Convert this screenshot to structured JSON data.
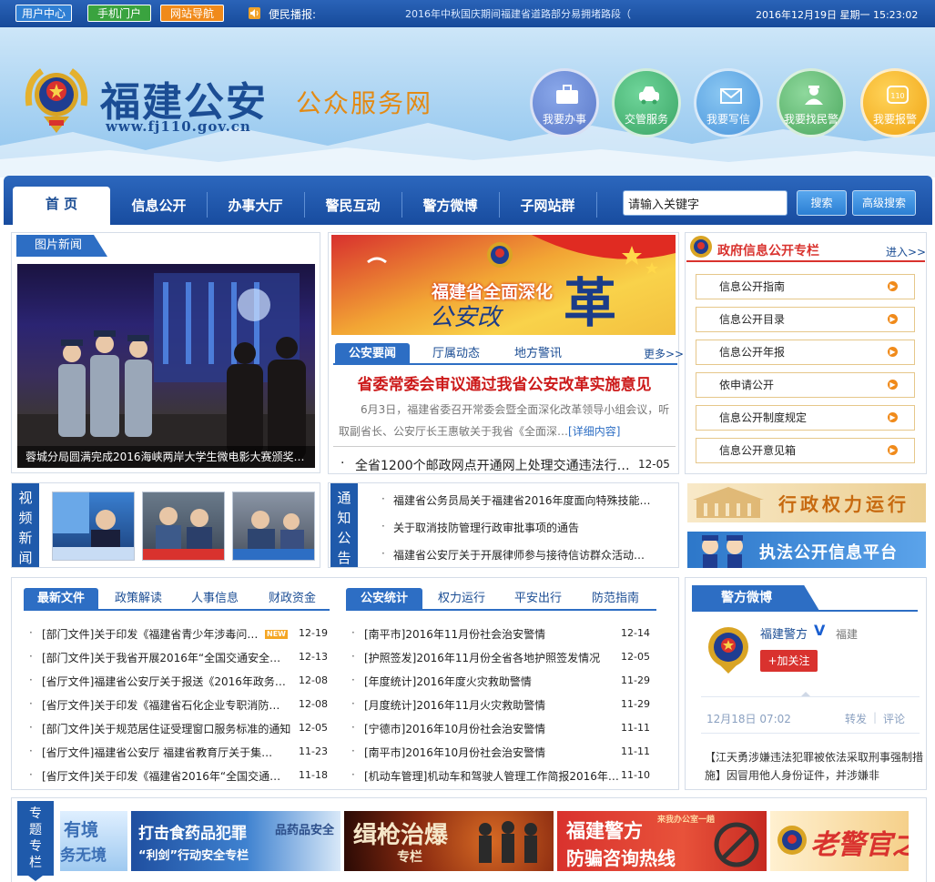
{
  "topbar": {
    "user_center": "用户中心",
    "mobile_portal": "手机门户",
    "site_nav": "网站导航",
    "notice_label": "便民播报:",
    "notice_text": "2016年中秋国庆期间福建省道路部分易拥堵路段（",
    "datetime": "2016年12月19日  星期一  15:23:02"
  },
  "header": {
    "logo_cn": "福建公安",
    "logo_sub": "公众服务网",
    "logo_url": "www.fj110.gov.cn",
    "services": [
      "我要办事",
      "交管服务",
      "我要写信",
      "我要找民警",
      "我要报警"
    ],
    "service_colors": [
      "#6f8fd8",
      "#4cba7a",
      "#5aa7e6",
      "#67c07a",
      "#f2b318"
    ]
  },
  "nav": {
    "items": [
      "首 页",
      "信息公开",
      "办事大厅",
      "警民互动",
      "警方微博",
      "子网站群"
    ],
    "search_placeholder": "请输入关键字",
    "search_btn": "搜索",
    "adv_search_btn": "高级搜索"
  },
  "picture_news": {
    "tab": "图片新闻",
    "caption": "蓉城分局圆满完成2016海峡两岸大学生微电影大赛颁奖…"
  },
  "reform": {
    "line1": "福建省全面深化",
    "line2": "公安改",
    "big": "革"
  },
  "news": {
    "tabs": [
      "公安要闻",
      "厅属动态",
      "地方警讯"
    ],
    "more": "更多>>",
    "headline": "省委常委会审议通过我省公安改革实施意见",
    "desc": "6月3日，福建省委召开常委会暨全面深化改革领导小组会议，听取副省长、公安厅长王惠敏关于我省《全面深…",
    "detail": "[详细内容]",
    "item_text": "全省1200个邮政网点开通网上处理交通违法行…",
    "item_date": "12-05"
  },
  "gov_info": {
    "title": "政府信息公开专栏",
    "more": "进入>>",
    "items": [
      "信息公开指南",
      "信息公开目录",
      "信息公开年报",
      "依申请公开",
      "信息公开制度规定",
      "信息公开意见箱"
    ]
  },
  "video": {
    "label": [
      "视",
      "频",
      "新",
      "闻"
    ]
  },
  "notice": {
    "label": [
      "通",
      "知",
      "公",
      "告"
    ],
    "items": [
      "福建省公务员局关于福建省2016年度面向特殊技能…",
      "关于取消技防管理行政审批事项的通告",
      "福建省公安厅关于开展律师参与接待信访群众活动…"
    ]
  },
  "banners": {
    "power": "行政权力运行",
    "law": "执法公开信息平台"
  },
  "docs": {
    "tabs": [
      "最新文件",
      "政策解读",
      "人事信息",
      "财政资金"
    ],
    "new_badge": "NEW",
    "items": [
      {
        "text": "[部门文件]关于印发《福建省青少年涉毒问…",
        "date": "12-19"
      },
      {
        "text": "[部门文件]关于我省开展2016年“全国交通安全…",
        "date": "12-13"
      },
      {
        "text": "[省厅文件]福建省公安厅关于报送《2016年政务…",
        "date": "12-08"
      },
      {
        "text": "[省厅文件]关于印发《福建省石化企业专职消防…",
        "date": "12-08"
      },
      {
        "text": "[部门文件]关于规范居住证受理窗口服务标准的通知",
        "date": "12-05"
      },
      {
        "text": "[省厅文件]福建省公安厅  福建省教育厅关于集…",
        "date": "11-23"
      },
      {
        "text": "[省厅文件]关于印发《福建省2016年“全国交通…",
        "date": "11-18"
      }
    ]
  },
  "stats": {
    "tabs": [
      "公安统计",
      "权力运行",
      "平安出行",
      "防范指南"
    ],
    "items": [
      {
        "text": "[南平市]2016年11月份社会治安警情",
        "date": "12-14"
      },
      {
        "text": "[护照签发]2016年11月份全省各地护照签发情况",
        "date": "12-05"
      },
      {
        "text": "[年度统计]2016年度火灾救助警情",
        "date": "11-29"
      },
      {
        "text": "[月度统计]2016年11月火灾救助警情",
        "date": "11-29"
      },
      {
        "text": "[宁德市]2016年10月份社会治安警情",
        "date": "11-11"
      },
      {
        "text": "[南平市]2016年10月份社会治安警情",
        "date": "11-11"
      },
      {
        "text": "[机动车管理]机动车和驾驶人管理工作简报2016年…",
        "date": "11-10"
      }
    ]
  },
  "weibo": {
    "tab": "警方微博",
    "name": "福建警方",
    "verified": "V",
    "location": "福建",
    "follow": "+加关注",
    "time": "12月18日 07:02",
    "repost": "转发",
    "sep": "|",
    "comment": "评论",
    "text": "【江天勇涉嫌违法犯罪被依法采取刑事强制措施】因冒用他人身份证件，并涉嫌非"
  },
  "special": {
    "label": [
      "专",
      "题",
      "专",
      "栏"
    ],
    "b1": [
      "有境",
      "务无境"
    ],
    "b2": [
      "打击食药品犯罪",
      "“利剑”行动安全专栏",
      "品药品安全"
    ],
    "b3": [
      "缉枪治爆",
      "专栏"
    ],
    "b4": [
      "福建警方",
      "防骗咨询热线",
      "来我办公室一趟"
    ],
    "b5": "老警官之"
  }
}
